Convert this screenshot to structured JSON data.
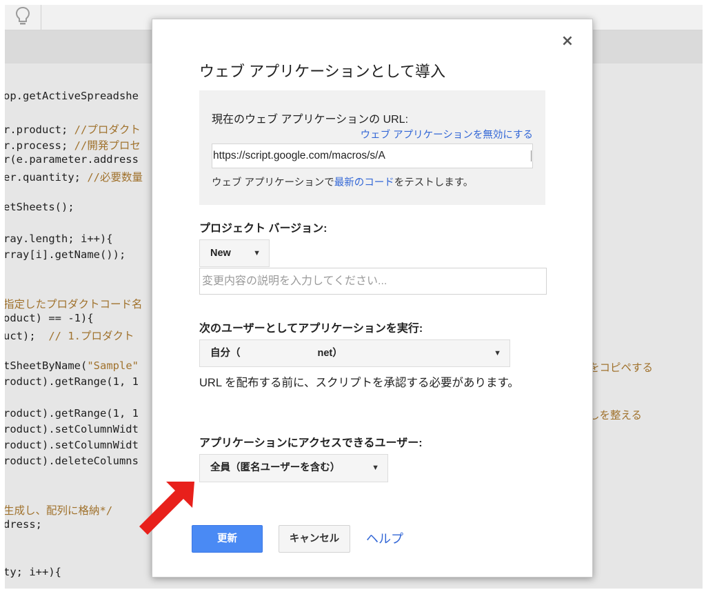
{
  "code_lines": [
    {
      "pre": "op.getActiveSpreadshe",
      "comment": ""
    },
    {
      "pre": "r.product; ",
      "comment": "//プロダクト"
    },
    {
      "pre": "r.process; ",
      "comment": "//開発プロセ"
    },
    {
      "pre": "r(e.parameter.address",
      "comment": ""
    },
    {
      "pre": "er.quantity; ",
      "comment": "//必要数量"
    },
    {
      "pre": "etSheets();",
      "comment": ""
    },
    {
      "pre": "ray.length; i++){",
      "comment": ""
    },
    {
      "pre": "rray[i].getName());",
      "comment": ""
    },
    {
      "pre": "",
      "comment": "指定したプロダクトコード名"
    },
    {
      "pre": "oduct) == -1){",
      "comment": ""
    },
    {
      "pre": "uct);  ",
      "comment": "// 1.プロダクト"
    },
    {
      "pre": "tSheetByName(",
      "string": "\"Sample\"",
      "comment": ""
    },
    {
      "pre": "roduct).getRange(1, 1",
      "comment": ""
    },
    {
      "pre": "roduct).getRange(1, 1",
      "comment": ""
    },
    {
      "pre": "roduct).setColumnWidt",
      "comment": ""
    },
    {
      "pre": "roduct).setColumnWidt",
      "comment": ""
    },
    {
      "pre": "roduct).deleteColumns",
      "comment": ""
    },
    {
      "pre": "",
      "comment": "生成し、配列に格納*/"
    },
    {
      "pre": "dress;",
      "comment": ""
    },
    {
      "pre": "ty; i++){",
      "comment": ""
    }
  ],
  "code_right": [
    "をコピペする",
    "しを整える"
  ],
  "dialog": {
    "title": "ウェブ アプリケーションとして導入",
    "close_glyph": "×",
    "url_label": "現在のウェブ アプリケーションの URL:",
    "disable_link": "ウェブ アプリケーションを無効にする",
    "url_value": "https://script.google.com/macros/s/A",
    "test_prefix": "ウェブ アプリケーションで",
    "test_link": "最新のコード",
    "test_suffix": "をテストします。",
    "project_version_label": "プロジェクト バージョン:",
    "version_select": "New",
    "description_placeholder": "変更内容の説明を入力してください...",
    "execute_as_label": "次のユーザーとしてアプリケーションを実行:",
    "execute_as_prefix": "自分（",
    "execute_as_suffix": "net）",
    "notice": "URL を配布する前に、スクリプトを承認する必要があります。",
    "access_label": "アプリケーションにアクセスできるユーザー:",
    "access_select": "全員（匿名ユーザーを含む）",
    "update_button": "更新",
    "cancel_button": "キャンセル",
    "help_link": "ヘルプ"
  },
  "colors": {
    "primary": "#4a8af4",
    "link": "#3367d6",
    "arrow": "#e8201b",
    "comment": "#a0722d"
  }
}
